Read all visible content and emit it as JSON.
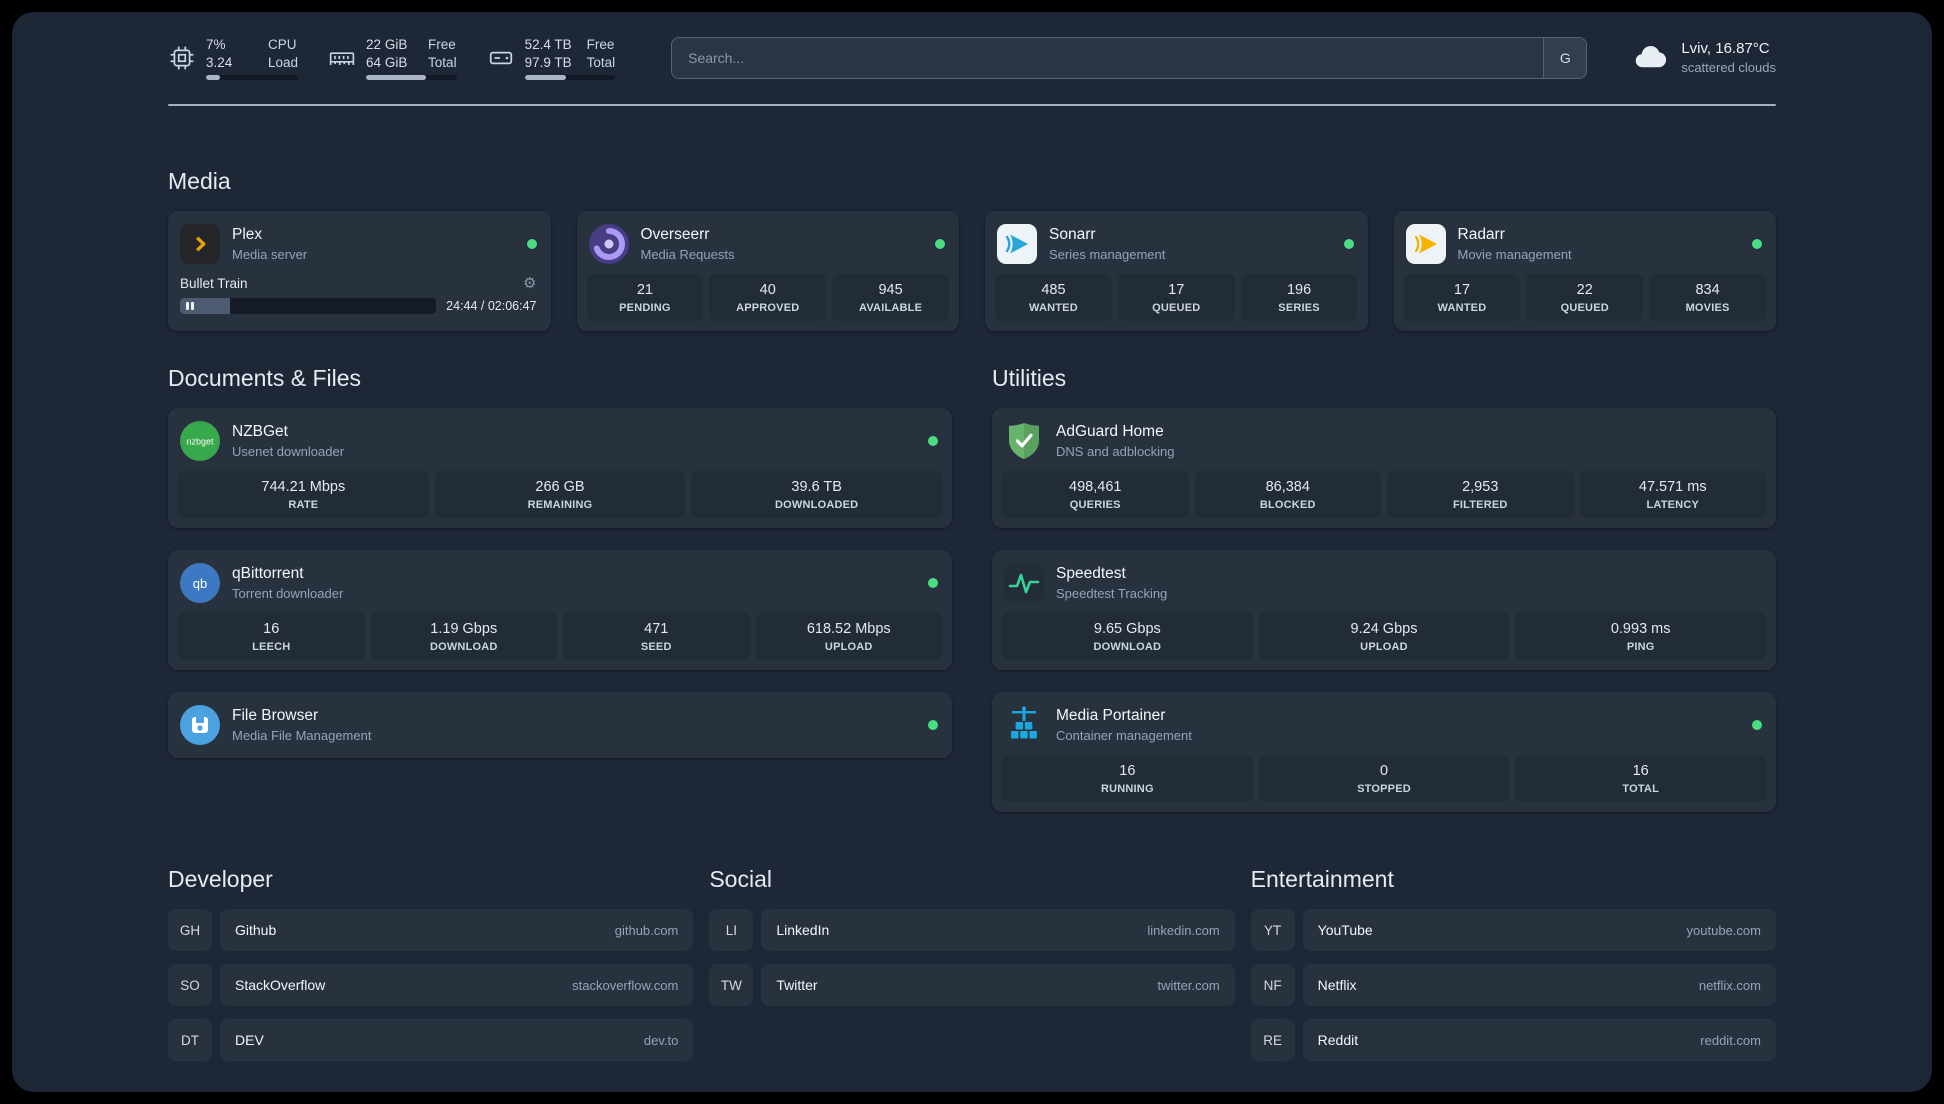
{
  "topbar": {
    "resources": [
      {
        "name": "cpu",
        "value_top": "7%",
        "value_bottom": "3.24",
        "label_top": "CPU",
        "label_bottom": "Load",
        "progress": 15
      },
      {
        "name": "memory",
        "value_top": "22 GiB",
        "value_bottom": "64 GiB",
        "label_top": "Free",
        "label_bottom": "Total",
        "progress": 66
      },
      {
        "name": "disk",
        "value_top": "52.4 TB",
        "value_bottom": "97.9 TB",
        "label_top": "Free",
        "label_bottom": "Total",
        "progress": 46
      }
    ],
    "search": {
      "placeholder": "Search...",
      "provider_label": "G"
    },
    "weather": {
      "location": "Lviv, 16.87°C",
      "condition": "scattered clouds"
    }
  },
  "sections": {
    "media": {
      "title": "Media",
      "services": [
        {
          "title": "Plex",
          "subtitle": "Media server",
          "status": "online",
          "now_playing": {
            "track": "Bullet Train",
            "time": "24:44 / 02:06:47",
            "progress": 19.5
          }
        },
        {
          "title": "Overseerr",
          "subtitle": "Media Requests",
          "status": "online",
          "stats": [
            {
              "value": "21",
              "label": "PENDING"
            },
            {
              "value": "40",
              "label": "APPROVED"
            },
            {
              "value": "945",
              "label": "AVAILABLE"
            }
          ]
        },
        {
          "title": "Sonarr",
          "subtitle": "Series management",
          "status": "online",
          "stats": [
            {
              "value": "485",
              "label": "WANTED"
            },
            {
              "value": "17",
              "label": "QUEUED"
            },
            {
              "value": "196",
              "label": "SERIES"
            }
          ]
        },
        {
          "title": "Radarr",
          "subtitle": "Movie management",
          "status": "online",
          "stats": [
            {
              "value": "17",
              "label": "WANTED"
            },
            {
              "value": "22",
              "label": "QUEUED"
            },
            {
              "value": "834",
              "label": "MOVIES"
            }
          ]
        }
      ]
    },
    "documents": {
      "title": "Documents & Files",
      "services": [
        {
          "title": "NZBGet",
          "subtitle": "Usenet downloader",
          "status": "online",
          "stats": [
            {
              "value": "744.21 Mbps",
              "label": "RATE"
            },
            {
              "value": "266 GB",
              "label": "REMAINING"
            },
            {
              "value": "39.6 TB",
              "label": "DOWNLOADED"
            }
          ]
        },
        {
          "title": "qBittorrent",
          "subtitle": "Torrent downloader",
          "status": "online",
          "stats": [
            {
              "value": "16",
              "label": "LEECH"
            },
            {
              "value": "1.19 Gbps",
              "label": "DOWNLOAD"
            },
            {
              "value": "471",
              "label": "SEED"
            },
            {
              "value": "618.52 Mbps",
              "label": "UPLOAD"
            }
          ]
        },
        {
          "title": "File Browser",
          "subtitle": "Media File Management",
          "status": "online",
          "stats": []
        }
      ]
    },
    "utilities": {
      "title": "Utilities",
      "services": [
        {
          "title": "AdGuard Home",
          "subtitle": "DNS and adblocking",
          "stats": [
            {
              "value": "498,461",
              "label": "QUERIES"
            },
            {
              "value": "86,384",
              "label": "BLOCKED"
            },
            {
              "value": "2,953",
              "label": "FILTERED"
            },
            {
              "value": "47.571 ms",
              "label": "LATENCY"
            }
          ]
        },
        {
          "title": "Speedtest",
          "subtitle": "Speedtest Tracking",
          "stats": [
            {
              "value": "9.65 Gbps",
              "label": "DOWNLOAD"
            },
            {
              "value": "9.24 Gbps",
              "label": "UPLOAD"
            },
            {
              "value": "0.993 ms",
              "label": "PING"
            }
          ]
        },
        {
          "title": "Media Portainer",
          "subtitle": "Container management",
          "status": "online",
          "stats": [
            {
              "value": "16",
              "label": "RUNNING"
            },
            {
              "value": "0",
              "label": "STOPPED"
            },
            {
              "value": "16",
              "label": "TOTAL"
            }
          ]
        }
      ]
    }
  },
  "bookmarks": [
    {
      "title": "Developer",
      "items": [
        {
          "abbr": "GH",
          "name": "Github",
          "url": "github.com"
        },
        {
          "abbr": "SO",
          "name": "StackOverflow",
          "url": "stackoverflow.com"
        },
        {
          "abbr": "DT",
          "name": "DEV",
          "url": "dev.to"
        }
      ]
    },
    {
      "title": "Social",
      "items": [
        {
          "abbr": "LI",
          "name": "LinkedIn",
          "url": "linkedin.com"
        },
        {
          "abbr": "TW",
          "name": "Twitter",
          "url": "twitter.com"
        }
      ]
    },
    {
      "title": "Entertainment",
      "items": [
        {
          "abbr": "YT",
          "name": "YouTube",
          "url": "youtube.com"
        },
        {
          "abbr": "NF",
          "name": "Netflix",
          "url": "netflix.com"
        },
        {
          "abbr": "RE",
          "name": "Reddit",
          "url": "reddit.com"
        }
      ]
    }
  ],
  "colors": {
    "status_online": "#4ade80",
    "plex_accent": "#e5a00d",
    "background": "#1d2736",
    "card": "#28313e"
  }
}
